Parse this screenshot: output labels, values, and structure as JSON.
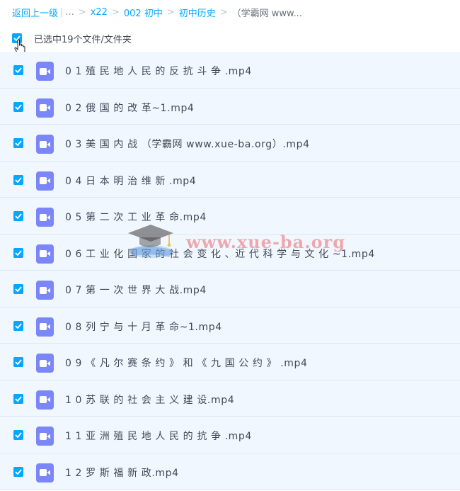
{
  "breadcrumb": {
    "back": "返回上一级",
    "ellipsis": "...",
    "items": [
      "x22",
      "002 初中",
      "初中历史"
    ],
    "current": "（学霸网 www..."
  },
  "selection": {
    "label": "已选中19个文件/文件夹"
  },
  "files": [
    {
      "name": "0 1 殖 民 地 人 民 的 反 抗 斗 争 .mp4",
      "checked": true
    },
    {
      "name": "0 2 俄 国 的 改 革~1.mp4",
      "checked": true
    },
    {
      "name": "0 3 美 国 内 战 （学霸网 www.xue-ba.org）.mp4",
      "checked": true
    },
    {
      "name": "0 4 日 本 明 治 维 新 .mp4",
      "checked": true
    },
    {
      "name": "0 5 第 二 次 工 业 革 命.mp4",
      "checked": true
    },
    {
      "name": "0 6 工 业 化 国 家 的 社 会 变 化 、近 代 科 学 与 文 化 ~1.mp4",
      "checked": true
    },
    {
      "name": "0 7 第 一 次 世 界 大 战.mp4",
      "checked": true
    },
    {
      "name": "0 8 列 宁 与 十 月 革 命~1.mp4",
      "checked": true
    },
    {
      "name": "0 9 《 凡 尔 赛 条 约 》 和 《 九 国 公 约 》 .mp4",
      "checked": true
    },
    {
      "name": "1 0 苏 联 的 社 会 主 义 建 设.mp4",
      "checked": true
    },
    {
      "name": "1 1 亚 洲 殖 民 地 人 民 的 抗 争 .mp4",
      "checked": true
    },
    {
      "name": "1 2 罗 斯 福 新 政.mp4",
      "checked": true
    }
  ],
  "watermark": {
    "text": "www.xue-ba.org"
  },
  "colors": {
    "accent": "#06a7ff",
    "video_icon": "#7b86f8",
    "row_selected": "#f1f7ff"
  },
  "icons": {
    "file": "video-file-icon",
    "check": "checkmark-icon",
    "cursor": "hand-pointer-icon"
  }
}
